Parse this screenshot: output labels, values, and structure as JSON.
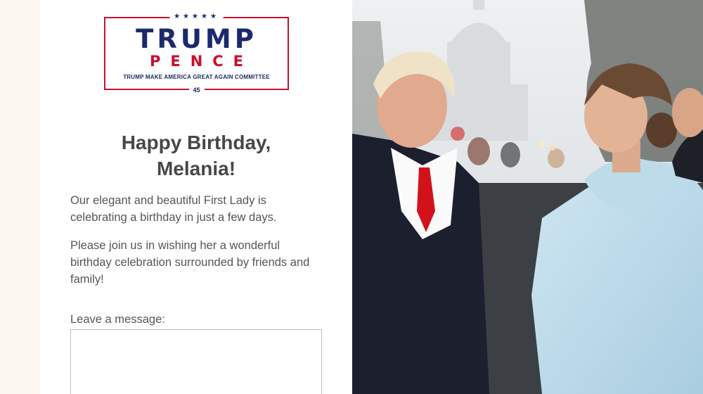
{
  "logo": {
    "stars": "★★★★★",
    "line1": "TRUMP",
    "line2": "PENCE",
    "tagline": "TRUMP MAKE AMERICA GREAT AGAIN COMMITTEE",
    "number": "45"
  },
  "headline": {
    "line1": "Happy Birthday,",
    "line2": "Melania!"
  },
  "body": {
    "paragraph1": "Our elegant and beautiful First Lady is celebrating a birthday in just a few days.",
    "paragraph2": "Please join us in wishing her a wonderful birthday celebration surrounded by friends and family!"
  },
  "form": {
    "message_label": "Leave a message:",
    "message_value": ""
  },
  "colors": {
    "navy": "#1b2a6b",
    "red": "#c8102e",
    "text": "#555555",
    "page_bg": "#fdf7f2"
  }
}
